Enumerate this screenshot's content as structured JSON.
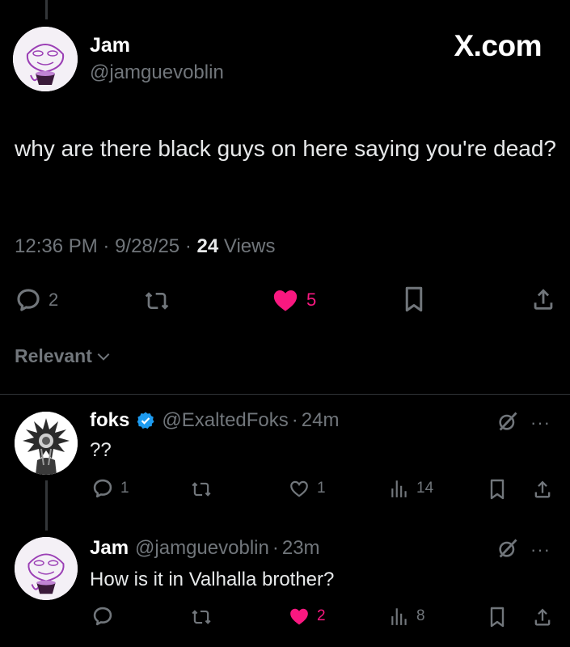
{
  "main_tweet": {
    "author_name": "Jam",
    "author_handle": "@jamguevoblin",
    "brand": "X.com",
    "text": "why are there black guys on here saying you're dead?",
    "time": "12:36 PM",
    "date": "9/28/25",
    "views_count": "24",
    "views_label": "Views",
    "replies": "2",
    "likes": "5",
    "liked": true
  },
  "sort": {
    "label": "Relevant"
  },
  "replies": [
    {
      "name": "foks",
      "verified": true,
      "handle": "@ExaltedFoks",
      "age": "24m",
      "text": "??",
      "replies": "1",
      "reposts": "",
      "likes": "1",
      "liked": false,
      "views": "14"
    },
    {
      "name": "Jam",
      "verified": false,
      "handle": "@jamguevoblin",
      "age": "23m",
      "text": "How is it in Valhalla brother?",
      "replies": "",
      "reposts": "",
      "likes": "2",
      "liked": true,
      "views": "8"
    }
  ],
  "separator": "·",
  "more_glyph": "···",
  "colors": {
    "like": "#f91880",
    "muted": "#71767b",
    "verified": "#1d9bf0",
    "background": "#000000"
  }
}
